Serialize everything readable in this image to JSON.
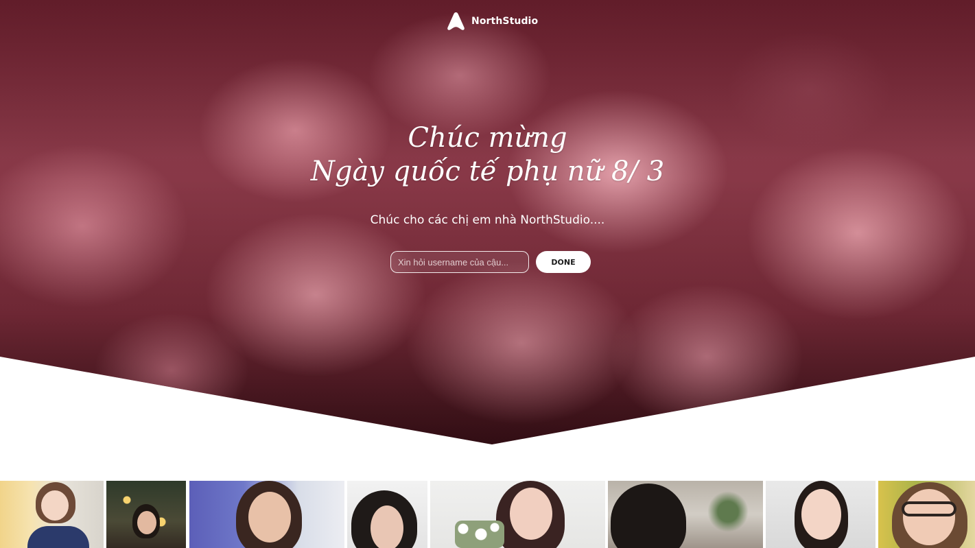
{
  "brand": {
    "name": "NorthStudio",
    "logo_icon": "triangle-logo-icon"
  },
  "hero": {
    "headline_line1": "Chúc mừng",
    "headline_line2": "Ngày quốc tế phụ nữ 8/ 3",
    "subtitle": "Chúc cho các chị em nhà NorthStudio....",
    "background": "pink roses"
  },
  "form": {
    "username_placeholder": "Xin hỏi username của cậu...",
    "username_value": "",
    "done_label": "DONE"
  },
  "colors": {
    "hero_dark": "#6e2331",
    "rose_pink": "#e6a0aa",
    "button_bg": "#ffffff"
  },
  "gallery": {
    "photos": [
      {
        "name": "portrait-1"
      },
      {
        "name": "portrait-2"
      },
      {
        "name": "portrait-3"
      },
      {
        "name": "portrait-4"
      },
      {
        "name": "portrait-5"
      },
      {
        "name": "portrait-6"
      },
      {
        "name": "portrait-7"
      },
      {
        "name": "portrait-8"
      }
    ]
  }
}
